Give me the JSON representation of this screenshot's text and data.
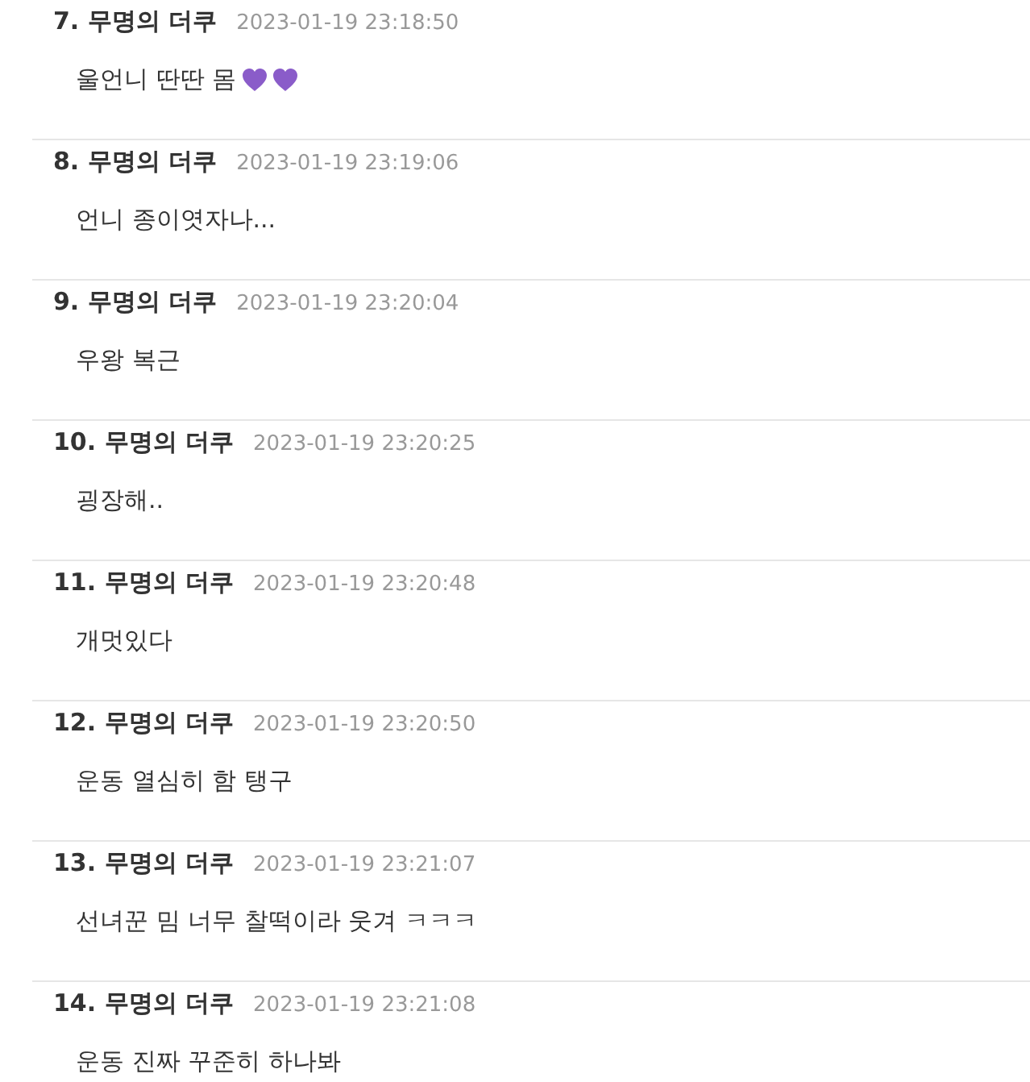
{
  "comments": [
    {
      "number": "7.",
      "author": "무명의 더쿠",
      "time": "2023-01-19 23:18:50",
      "text": "울언니 딴딴 몸",
      "kind": "hearts"
    },
    {
      "number": "8.",
      "author": "무명의 더쿠",
      "time": "2023-01-19 23:19:06",
      "text": "언니 종이엿자나...",
      "kind": "plain"
    },
    {
      "number": "9.",
      "author": "무명의 더쿠",
      "time": "2023-01-19 23:20:04",
      "text": "우왕 복근",
      "kind": "plain"
    },
    {
      "number": "10.",
      "author": "무명의 더쿠",
      "time": "2023-01-19 23:20:25",
      "text": "굉장해..",
      "kind": "plain"
    },
    {
      "number": "11.",
      "author": "무명의 더쿠",
      "time": "2023-01-19 23:20:48",
      "text": "개멋있다",
      "kind": "plain"
    },
    {
      "number": "12.",
      "author": "무명의 더쿠",
      "time": "2023-01-19 23:20:50",
      "text": "운동 열심히 함 탱구",
      "kind": "plain"
    },
    {
      "number": "13.",
      "author": "무명의 더쿠",
      "time": "2023-01-19 23:21:07",
      "text": "선녀꾼 밈 너무 찰떡이라 웃겨 ㅋㅋㅋ",
      "kind": "plain"
    },
    {
      "number": "14.",
      "author": "무명의 더쿠",
      "time": "2023-01-19 23:21:08",
      "text": "운동 진짜 꾸준히 하나봐",
      "kind": "plain"
    }
  ]
}
